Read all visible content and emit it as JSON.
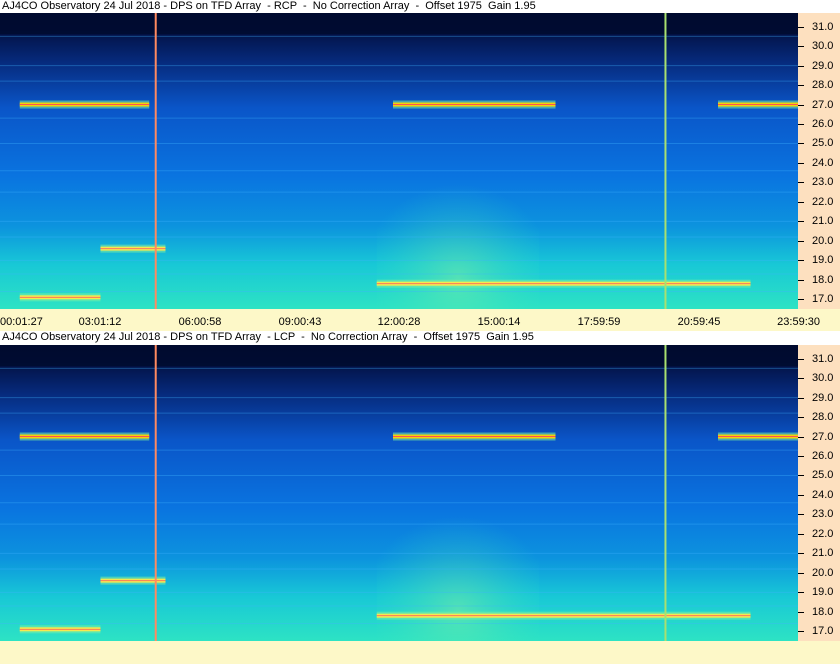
{
  "panels": [
    {
      "title": "AJ4CO Observatory 24 Jul 2018 - DPS on TFD Array  - RCP  -  No Correction Array  -  Offset 1975  Gain 1.95",
      "polarization": "RCP"
    },
    {
      "title": "AJ4CO Observatory 24 Jul 2018 - DPS on TFD Array  - LCP  -  No Correction Array  -  Offset 1975  Gain 1.95",
      "polarization": "LCP"
    }
  ],
  "x_tick_labels": [
    "00:01:27",
    "03:01:12",
    "06:00:58",
    "09:00:43",
    "12:00:28",
    "15:00:14",
    "17:59:59",
    "20:59:45",
    "23:59:30"
  ],
  "y_tick_labels": [
    "31.0",
    "30.0",
    "29.0",
    "28.0",
    "27.0",
    "26.0",
    "25.0",
    "24.0",
    "23.0",
    "22.0",
    "21.0",
    "20.0",
    "19.0",
    "18.0",
    "17.0"
  ],
  "colors": {
    "low": "#000a3a",
    "mid": "#0a5ad8",
    "high": "#27e6d0",
    "hot": "#ffd400",
    "scale_bg": "#fde0bf",
    "axis_bg": "#fdf8c8"
  },
  "chart_data": [
    {
      "type": "heatmap",
      "title": "AJ4CO Observatory 24 Jul 2018 - DPS on TFD Array  - RCP  -  No Correction Array  -  Offset 1975  Gain 1.95",
      "x_ticks": [
        "00:01:27",
        "03:01:12",
        "06:00:58",
        "09:00:43",
        "12:00:28",
        "15:00:14",
        "17:59:59",
        "20:59:45",
        "23:59:30"
      ],
      "y_ticks": [
        31.0,
        30.0,
        29.0,
        28.0,
        27.0,
        26.0,
        25.0,
        24.0,
        23.0,
        22.0,
        21.0,
        20.0,
        19.0,
        18.0,
        17.0
      ],
      "ylim": [
        16.5,
        31.7
      ],
      "time_markers": [
        "04:12",
        "19:53"
      ],
      "strong_bands": [
        {
          "freq": 27.0,
          "from": "00:01",
          "to": "04:00"
        },
        {
          "freq": 27.0,
          "from": "11:30",
          "to": "16:30"
        },
        {
          "freq": 27.0,
          "from": "21:30",
          "to": "23:59"
        },
        {
          "freq": 17.8,
          "from": "11:00",
          "to": "22:30"
        },
        {
          "freq": 19.6,
          "from": "02:30",
          "to": "04:30"
        },
        {
          "freq": 17.1,
          "from": "00:01",
          "to": "02:30"
        }
      ]
    },
    {
      "type": "heatmap",
      "title": "AJ4CO Observatory 24 Jul 2018 - DPS on TFD Array  - LCP  -  No Correction Array  -  Offset 1975  Gain 1.95",
      "x_ticks": [],
      "y_ticks": [
        31.0,
        30.0,
        29.0,
        28.0,
        27.0,
        26.0,
        25.0,
        24.0,
        23.0,
        22.0,
        21.0,
        20.0,
        19.0,
        18.0,
        17.0
      ],
      "ylim": [
        16.5,
        31.7
      ],
      "time_markers": [
        "04:12",
        "19:53"
      ],
      "strong_bands": [
        {
          "freq": 27.0,
          "from": "00:01",
          "to": "04:00"
        },
        {
          "freq": 27.0,
          "from": "11:30",
          "to": "16:30"
        },
        {
          "freq": 27.0,
          "from": "21:30",
          "to": "23:59"
        },
        {
          "freq": 17.8,
          "from": "11:00",
          "to": "22:30"
        },
        {
          "freq": 19.6,
          "from": "02:30",
          "to": "04:30"
        },
        {
          "freq": 17.1,
          "from": "00:01",
          "to": "02:30"
        }
      ]
    }
  ]
}
